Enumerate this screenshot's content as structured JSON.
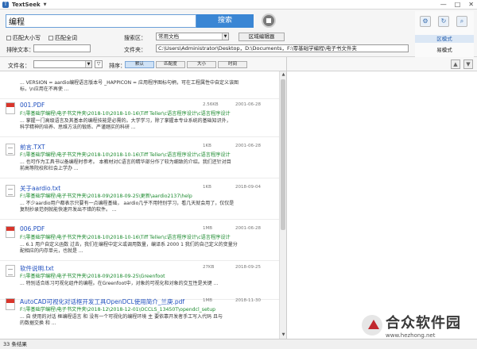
{
  "window": {
    "title": "TextSeek",
    "controls": [
      "—",
      "□",
      "✕"
    ]
  },
  "search": {
    "value": "编程",
    "button_label": "搜索"
  },
  "options": {
    "match_case": "匹配大小写",
    "match_whole_word": "匹配全词",
    "exclude_text_label": "排除文本：",
    "search_area_label": "搜索区：",
    "search_area_value": "常用文档",
    "area_editor_button": "区域编辑器",
    "folder_label": "文件夹：",
    "folder_path": "C:\\Users\\Administrator\\Desktop，D:\\Documents，F:\\零基础学编程\\电子书文件夹"
  },
  "right_panel": {
    "mode_a": "区模式",
    "mode_b": "易模式"
  },
  "sortbar": {
    "filename_label": "文件名：",
    "sort_label": "排序：",
    "buttons": [
      "默认",
      "匹配度",
      "大小",
      "时间"
    ]
  },
  "results": [
    {
      "type": "txt",
      "name": "",
      "size": "",
      "date": "",
      "path": "",
      "snippet1": "... VERSION = aardio编程语言版本号 _HAPPICON = 应用程序图标句柄，可在工程属性中自定义该图",
      "snippet2": "标，\\n应用在不再使 ..."
    },
    {
      "type": "pdf",
      "name": "001.PDF",
      "size": "2.56KB",
      "date": "2001-06-28",
      "path": "F:\\零基础学编程\\电子书文件夹\\2018-10\\2018-10-16\\Tiff Teller\\c语言程序设计\\c语言程序设计",
      "snippet1": "... 掌握一门高级语言及其基本的编程技能是必需的。大学学习，除了掌握本专业系统的基础知识外，",
      "snippet2": "科学精神的培养、思维方法的锻炼、严谨踏实的科研 ..."
    },
    {
      "type": "txt",
      "name": "前言.TXT",
      "size": "1KB",
      "date": "2001-06-28",
      "path": "F:\\零基础学编程\\电子书文件夹\\2018-10\\2018-10-16\\Tiff Teller\\c语言程序设计\\c语言程序设计",
      "snippet1": "... 也可作为工具书以备编程时参考。 本教材对C语言的精华部分作了较为细致的介绍。我们还针对目",
      "snippet2": "前高等院校和社会上学办 ..."
    },
    {
      "type": "txt",
      "name": "关于aardio.txt",
      "size": "1KB",
      "date": "2018-09-04",
      "path": "F:\\零基础学编程\\电子书文件夹\\2018-09\\2018-09-25\\更新\\aardio2137\\help",
      "snippet1": "... 不少aardio用户都表示只要有一点编程基础， aardio几乎不用特别学习，看几天就会用了，仅仅是",
      "snippet2": "复制抄录范例就能快速开发出不错的软件。 ..."
    },
    {
      "type": "pdf",
      "name": "006.PDF",
      "size": "1MB",
      "date": "2001-06-28",
      "path": "F:\\零基础学编程\\电子书文件夹\\2018-10\\2018-10-16\\Tiff Teller\\c语言程序设计\\c语言程序设计",
      "snippet1": "... 6.1 用户自定义函数 过去，我们在编程中定义或调用数量，编译系 2000 1 我们的自己定义的变量分",
      "snippet2": "配相应的内存单元，也就是 ..."
    },
    {
      "type": "txt",
      "name": "软件说明.txt",
      "size": "27KB",
      "date": "2018-09-25",
      "path": "F:\\零基础学编程\\电子书文件夹\\2018-09\\2018-09-25\\Greenfoot",
      "snippet1": "... 特别适合练习可视化组件的编程。在Greenfoot中，对象的可视化和对象的交互性是关键 ...",
      "snippet2": ""
    },
    {
      "type": "pdf",
      "name": "AutoCAD可视化对话框开发工具OpenDCL使用简介_兰庚.pdf",
      "size": "1MB",
      "date": "2018-11-30",
      "path": "F:\\零基础学编程\\电子书文件夹\\2018-12\\2018-12-01\\OCCLS_13450T\\opendcl_setup",
      "snippet1": "... 自 使用的对话 框编程语言 和 没有一个可视化的编程环境 主 要依靠开发者手工写入代码 且与",
      "snippet2": "的数据交换 和 ..."
    }
  ],
  "status": {
    "count_text": "33 条结果"
  },
  "watermark": {
    "name": "合众软件园",
    "url": "www.hezhong.net"
  }
}
